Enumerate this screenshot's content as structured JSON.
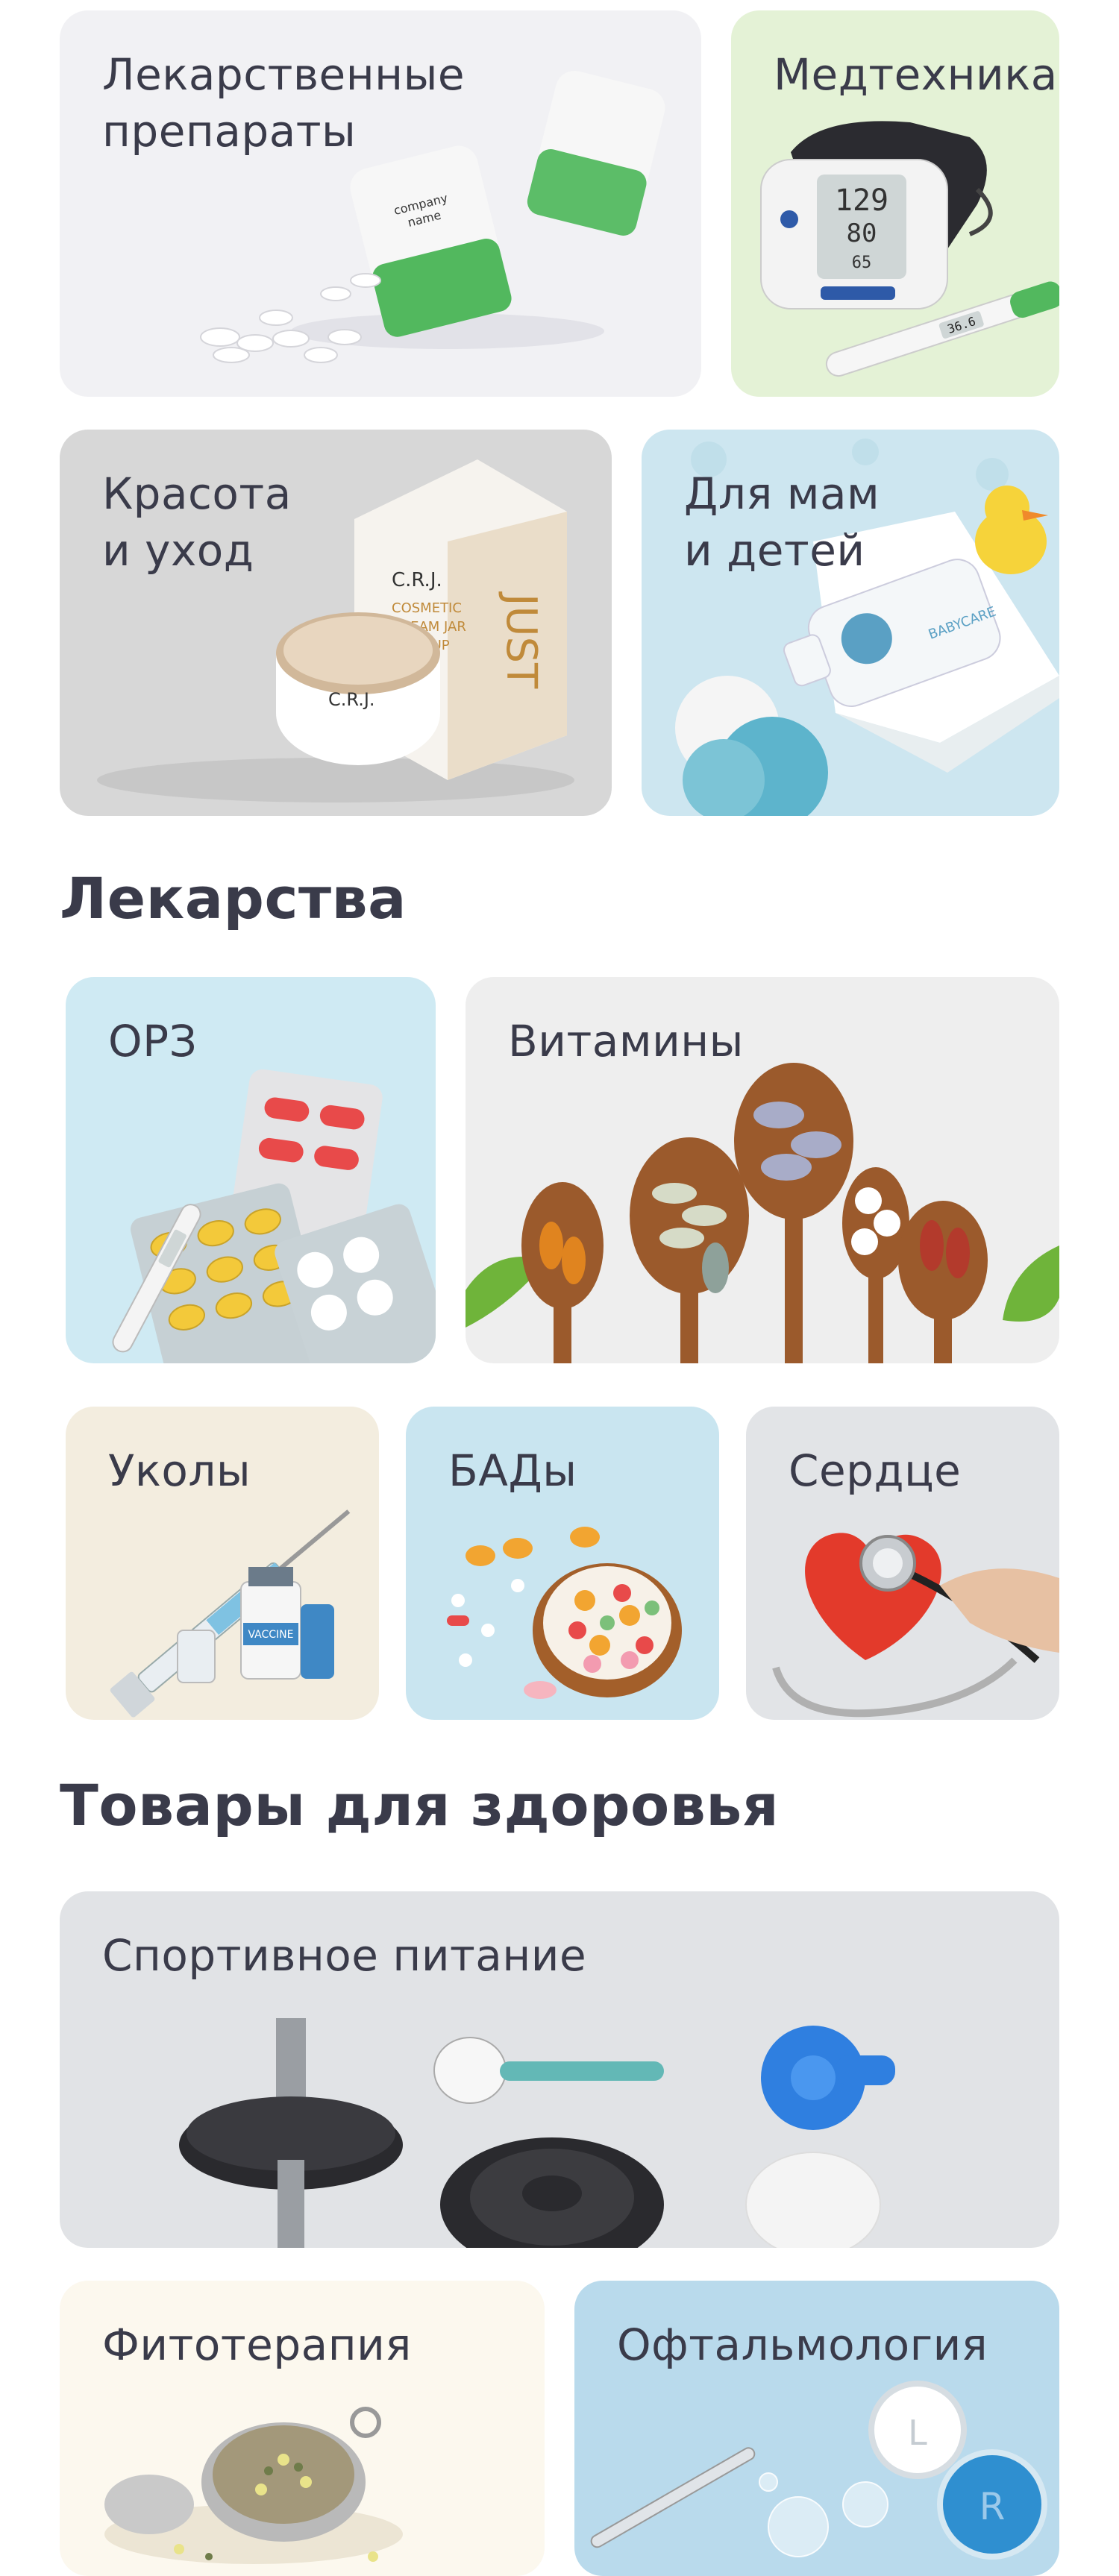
{
  "top_categories": [
    {
      "label": "Лекарственные\nпрепараты"
    },
    {
      "label": "Медтехника"
    },
    {
      "label": "Красота\nи уход"
    },
    {
      "label": "Для мам\nи детей"
    }
  ],
  "medicines": {
    "title": "Лекарства",
    "items": [
      {
        "label": "ОРЗ"
      },
      {
        "label": "Витамины"
      },
      {
        "label": "Уколы"
      },
      {
        "label": "БАДы"
      },
      {
        "label": "Сердце"
      }
    ]
  },
  "health_goods": {
    "title": "Товары для здоровья",
    "items": [
      {
        "label": "Спортивное питание"
      },
      {
        "label": "Фитотерапия"
      },
      {
        "label": "Офтальмология"
      }
    ]
  },
  "product_texts": {
    "jar_brand": "C.R.J.",
    "jar_line1": "COSMETIC",
    "jar_line2": "CREAM JAR",
    "jar_line3": "MOCKUP",
    "box_brand": "JUST",
    "bottle_brand": "company\nname",
    "baby_brand": "BABYCARE",
    "vaccine": "VACCINE",
    "bp_sys": "129",
    "bp_dia": "80",
    "bp_pulse": "65",
    "thermo": "36.6",
    "lens_l": "L",
    "lens_r": "R"
  }
}
